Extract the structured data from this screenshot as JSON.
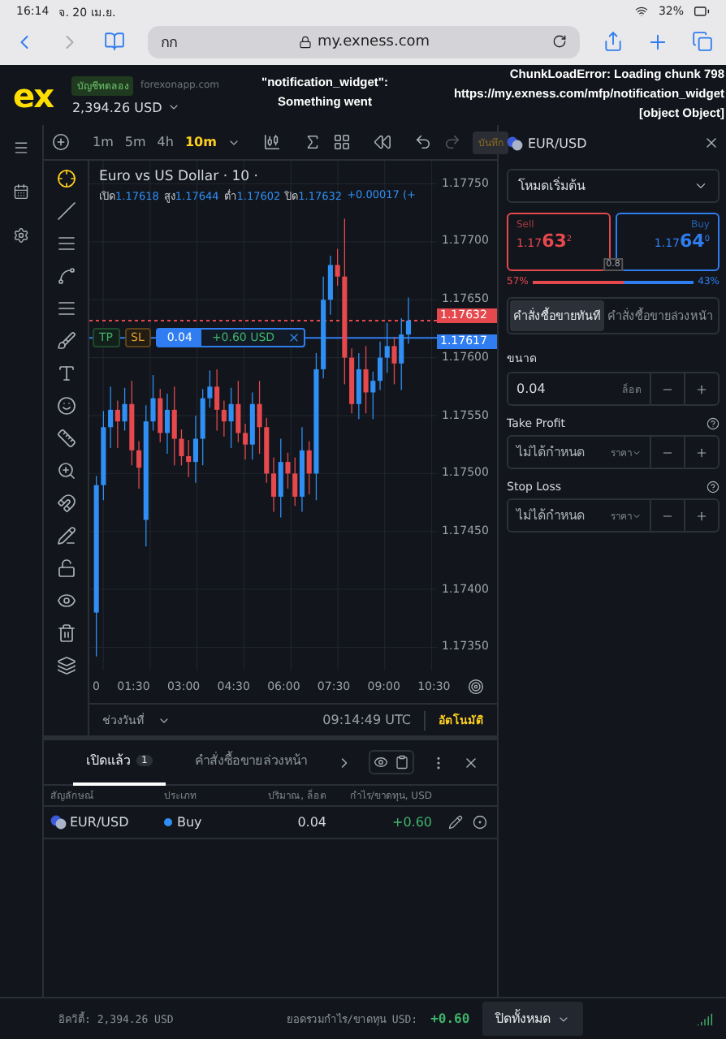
{
  "status_bar": {
    "time": "16:14",
    "date": "จ. 20 เม.ย.",
    "battery": "32%"
  },
  "browser": {
    "tab_text": "กก",
    "url": "my.exness.com"
  },
  "header": {
    "logo": "ex",
    "account_badge": "บัญชีทดลอง",
    "server": "forexonapp.com",
    "balance": "2,394.26 USD",
    "error_left": [
      "\"notification_widget\":",
      "Something went"
    ],
    "error_right": [
      "ChunkLoadError: Loading chunk 798",
      "https://my.exness.com/mfp/notification_widget",
      "[object Object]"
    ]
  },
  "toolbar": {
    "timeframes": [
      {
        "label": "1m",
        "selected": false
      },
      {
        "label": "5m",
        "selected": false
      },
      {
        "label": "4h",
        "selected": false
      },
      {
        "label": "10m",
        "selected": true
      }
    ],
    "save_label": "บันทึก"
  },
  "chart": {
    "title": "Euro vs US Dollar · 10 ·",
    "ohlc": [
      {
        "label": "เปิด",
        "value": "1.17618"
      },
      {
        "label": "สูง",
        "value": "1.17644"
      },
      {
        "label": "ต่ำ",
        "value": "1.17602"
      },
      {
        "label": "ปิด",
        "value": "1.17632"
      }
    ],
    "change": "+0.00017 (+",
    "chart_data": {
      "type": "candlestick",
      "categories": [
        null,
        null,
        null,
        null,
        null,
        null,
        null,
        null,
        null,
        null,
        null,
        null,
        null,
        null,
        null,
        null,
        null,
        null,
        null,
        null,
        null,
        null,
        null,
        null,
        null,
        null,
        null,
        null,
        null,
        null,
        null,
        null,
        null,
        null,
        null,
        null,
        null,
        null,
        null,
        null,
        null,
        null,
        null,
        null,
        null
      ],
      "yticks": [
        {
          "value": 1.1775,
          "label": "1.17750"
        },
        {
          "value": 1.177,
          "label": "1.17700"
        },
        {
          "value": 1.1765,
          "label": "1.17650"
        },
        {
          "value": 1.176,
          "label": "1.17600"
        },
        {
          "value": 1.1755,
          "label": "1.17550"
        },
        {
          "value": 1.175,
          "label": "1.17500"
        },
        {
          "value": 1.1745,
          "label": "1.17450"
        },
        {
          "value": 1.174,
          "label": "1.17400"
        },
        {
          "value": 1.1735,
          "label": "1.17350"
        }
      ],
      "ohlc": [
        [
          1.1738,
          1.17498,
          1.17342,
          1.1749
        ],
        [
          1.1749,
          1.17554,
          1.17477,
          1.1754
        ],
        [
          1.1754,
          1.17575,
          1.17522,
          1.17555
        ],
        [
          1.17555,
          1.17563,
          1.17522,
          1.17545
        ],
        [
          1.17545,
          1.17574,
          1.17537,
          1.1756
        ],
        [
          1.1756,
          1.1758,
          1.17507,
          1.1752
        ],
        [
          1.1752,
          1.17528,
          1.17487,
          1.17505
        ],
        [
          1.1746,
          1.17559,
          1.17437,
          1.17545
        ],
        [
          1.17545,
          1.17585,
          1.17537,
          1.17565
        ],
        [
          1.17565,
          1.17573,
          1.17527,
          1.17535
        ],
        [
          1.17535,
          1.17569,
          1.17517,
          1.17555
        ],
        [
          1.17555,
          1.17575,
          1.17507,
          1.1753
        ],
        [
          1.1753,
          1.17538,
          1.17507,
          1.17515
        ],
        [
          1.17515,
          1.17529,
          1.17497,
          1.1751
        ],
        [
          1.1751,
          1.1755,
          1.17492,
          1.1753
        ],
        [
          1.1753,
          1.17573,
          1.17507,
          1.17565
        ],
        [
          1.17565,
          1.17589,
          1.17557,
          1.17575
        ],
        [
          1.17575,
          1.1759,
          1.17537,
          1.17555
        ],
        [
          1.17555,
          1.17563,
          1.17532,
          1.17545
        ],
        [
          1.17545,
          1.17574,
          1.17522,
          1.1756
        ],
        [
          1.1756,
          1.1758,
          1.17527,
          1.17535
        ],
        [
          1.17535,
          1.17543,
          1.17512,
          1.17525
        ],
        [
          1.17525,
          1.1757,
          1.17512,
          1.1756
        ],
        [
          1.1756,
          1.1758,
          1.17517,
          1.1754
        ],
        [
          1.1754,
          1.17548,
          1.17492,
          1.175
        ],
        [
          1.175,
          1.17514,
          1.17467,
          1.1748
        ],
        [
          1.1748,
          1.1753,
          1.17462,
          1.1751
        ],
        [
          1.1751,
          1.17518,
          1.17487,
          1.175
        ],
        [
          1.175,
          1.17514,
          1.17472,
          1.1748
        ],
        [
          1.1748,
          1.1754,
          1.17467,
          1.1752
        ],
        [
          1.1752,
          1.17528,
          1.17482,
          1.175
        ],
        [
          1.175,
          1.17604,
          1.17477,
          1.1759
        ],
        [
          1.1759,
          1.1767,
          1.17582,
          1.1765
        ],
        [
          1.1765,
          1.17688,
          1.17637,
          1.1768
        ],
        [
          1.1768,
          1.17694,
          1.17662,
          1.1767
        ],
        [
          1.1767,
          1.1772,
          1.17577,
          1.176
        ],
        [
          1.176,
          1.17608,
          1.17552,
          1.1756
        ],
        [
          1.1756,
          1.17604,
          1.17547,
          1.1759
        ],
        [
          1.1759,
          1.1761,
          1.17552,
          1.1757
        ],
        [
          1.1757,
          1.17588,
          1.17547,
          1.1758
        ],
        [
          1.1758,
          1.17614,
          1.17572,
          1.176
        ],
        [
          1.176,
          1.1763,
          1.17587,
          1.1761
        ],
        [
          1.1761,
          1.17618,
          1.17577,
          1.17595
        ],
        [
          1.17595,
          1.17634,
          1.17572,
          1.1762
        ],
        [
          1.1762,
          1.17652,
          1.17612,
          1.17632
        ]
      ],
      "ylim": [
        1.1733,
        1.1777
      ],
      "grid": true,
      "ref_lines": [
        {
          "axis": "y",
          "value": 1.17632,
          "label": "1.17632",
          "color": "#e5484d"
        },
        {
          "axis": "y",
          "value": 1.17617,
          "label": "1.17617",
          "color": "#2f7df0"
        }
      ]
    },
    "time_axis": [
      "0",
      "01:30",
      "03:00",
      "04:30",
      "06:00",
      "07:30",
      "09:00",
      "10:30"
    ],
    "position": {
      "tp": "TP",
      "sl": "SL",
      "volume": "0.04",
      "pnl": "+0.60 USD"
    },
    "range_label": "ช่วงวันที่",
    "clock": "09:14:49 UTC",
    "auto_label": "อัตโนมัติ"
  },
  "order_panel": {
    "symbol": "EUR/USD",
    "mode": "โหมดเริ่มต้น",
    "sell": {
      "label": "Sell",
      "price": "1.17",
      "big": "63",
      "small": "2"
    },
    "buy": {
      "label": "Buy",
      "price": "1.17",
      "big": "64",
      "small": "0"
    },
    "spread": "0.8",
    "sell_pct": "57%",
    "buy_pct": "43%",
    "level": 0.57,
    "order_tabs": [
      {
        "label": "คำสั่งซื้อขายทันที",
        "selected": true
      },
      {
        "label": "คำสั่งซื้อขายล่วงหน้า",
        "selected": false
      }
    ],
    "volume": {
      "label": "ขนาด",
      "value": "0.04",
      "unit": "ล็อต"
    },
    "take_profit": {
      "label": "Take Profit",
      "placeholder": "ไม่ได้กำหนด",
      "unit": "ราคา"
    },
    "stop_loss": {
      "label": "Stop Loss",
      "placeholder": "ไม่ได้กำหนด",
      "unit": "ราคา"
    }
  },
  "positions": {
    "tabs": [
      {
        "label": "เปิดแล้ว",
        "count": "1",
        "selected": true
      },
      {
        "label": "คำสั่งซื้อขายล่วงหน้า",
        "selected": false
      }
    ],
    "columns": [
      "สัญลักษณ์",
      "ประเภท",
      "ปริมาณ, ล็อต",
      "กำไร/ขาดทุน, USD"
    ],
    "rows": [
      {
        "symbol": "EUR/USD",
        "type": "Buy",
        "color": "#2f8ff5",
        "volume": "0.04",
        "pnl": "+0.60"
      }
    ]
  },
  "footer": {
    "equity": "อิควิตี้: 2,394.26 USD",
    "total_label": "ยอดรวมกำไร/ขาดทุน USD:",
    "total": "+0.60",
    "close_all": "ปิดทั้งหมด"
  }
}
